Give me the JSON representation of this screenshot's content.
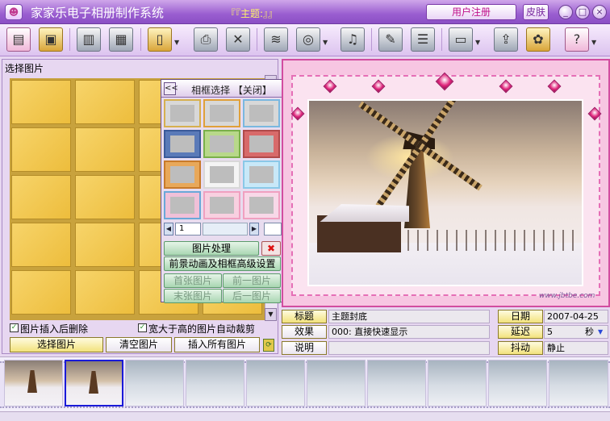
{
  "window": {
    "title": "家家乐电子相册制作系统",
    "doc_title": "『『主题:』』",
    "register_label": "用户注册",
    "skin_label": "皮肤",
    "min": "_",
    "max": "□",
    "close": "×"
  },
  "left": {
    "header": "选择图片",
    "check1": "图片插入后删除",
    "check2": "宽大于高的图片自动裁剪",
    "btn_select": "选择图片",
    "btn_clear": "清空图片",
    "btn_insert_all": "插入所有图片"
  },
  "frame_popup": {
    "back": "<<",
    "title": "相框选择 【关闭】",
    "page": "1",
    "btn_process": "图片处理",
    "btn_close": "✖",
    "btn_advanced": "前景动画及相框高级设置",
    "btn_first": "首张图片",
    "btn_prev": "前一图片",
    "btn_last": "末张图片",
    "btn_next": "后一图片"
  },
  "props": {
    "title_label": "标题",
    "title_value": "主题封底",
    "effect_label": "效果",
    "effect_value": "000: 直接快速显示",
    "desc_label": "说明",
    "desc_value": "",
    "date_label": "日期",
    "date_value": "2007-04-25",
    "delay_label": "延迟",
    "delay_value": "5",
    "delay_unit": "秒",
    "jitter_label": "抖动",
    "jitter_value": "静止"
  },
  "watermark": "www.jbtbe.com",
  "icons": [
    "new-album-icon",
    "open-album-icon",
    "save-icon",
    "save-as-icon",
    "frame-icon",
    "print-icon",
    "delete-icon",
    "background-icon",
    "disc-icon",
    "music-icon",
    "text-icon",
    "settings-icon",
    "screen-icon",
    "export-icon",
    "paint-icon",
    "help-icon"
  ],
  "colors": {
    "accent": "#9a5ed0",
    "frame_pink": "#d24da0",
    "button_yellow": "#f2e27c",
    "button_green": "#a9d6b2",
    "selected": "#1a1ad8"
  }
}
